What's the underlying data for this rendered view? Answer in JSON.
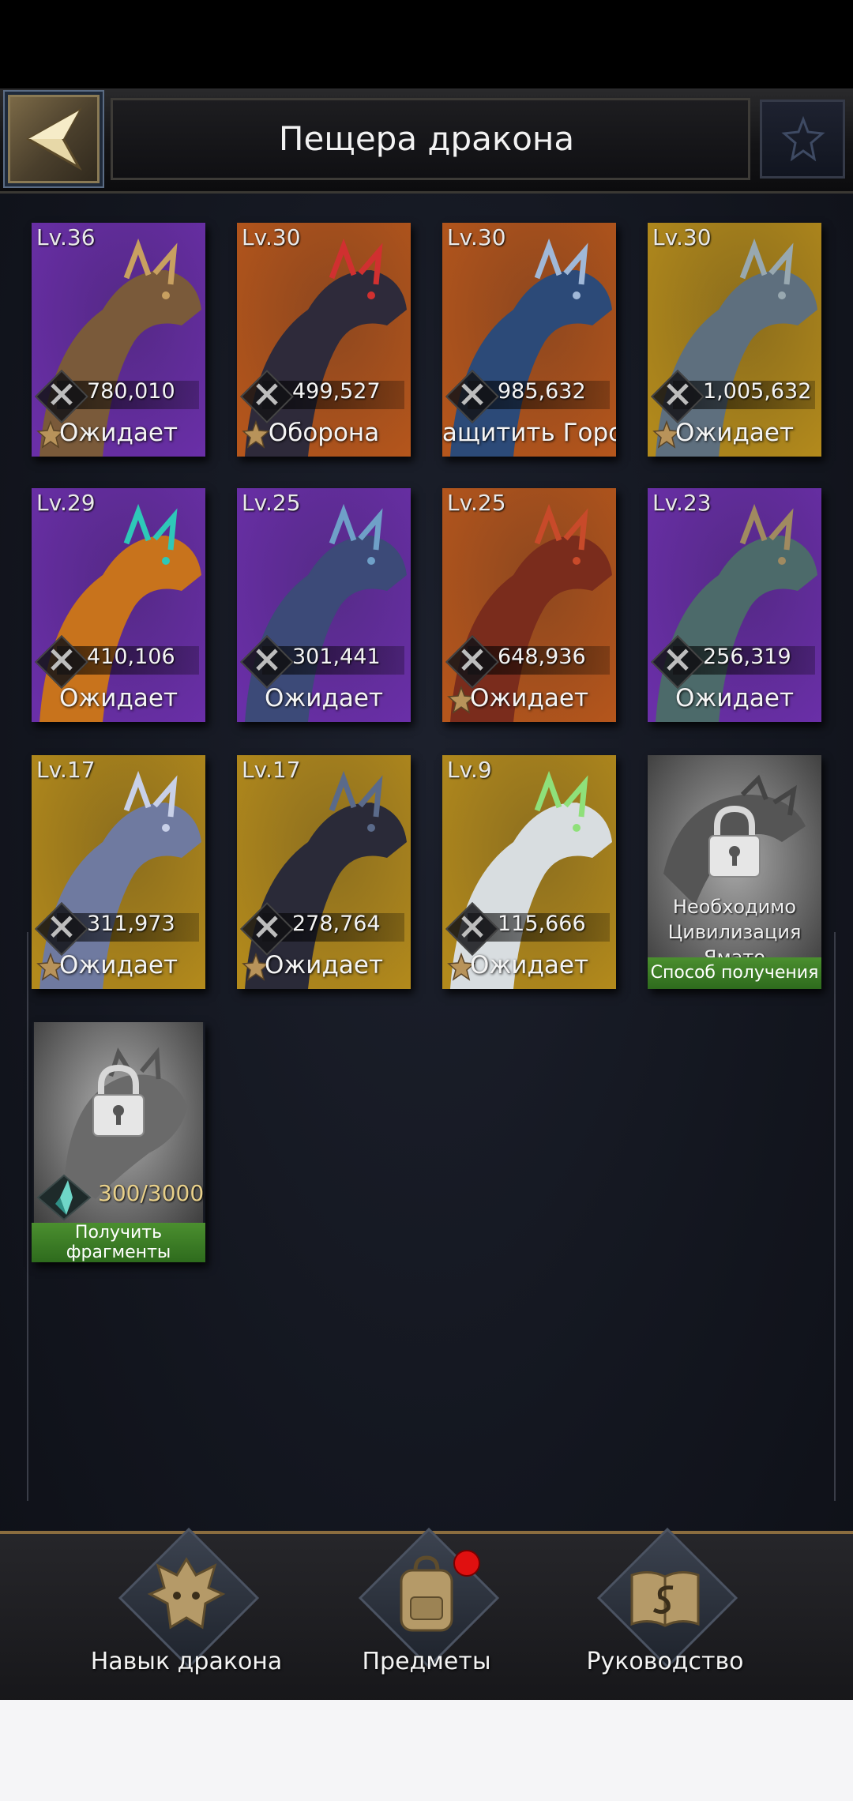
{
  "header": {
    "title": "Пещера дракона"
  },
  "dragons": [
    {
      "level": "Lv.36",
      "power": "780,010",
      "status": "Ожидает",
      "star": true,
      "bg": "#6a2fa8"
    },
    {
      "level": "Lv.30",
      "power": "499,527",
      "status": "Оборона",
      "star": true,
      "bg": "#b5561c"
    },
    {
      "level": "Lv.30",
      "power": "985,632",
      "status": "Защитить Город",
      "star": false,
      "bg": "#b5561c"
    },
    {
      "level": "Lv.30",
      "power": "1,005,632",
      "status": "Ожидает",
      "star": true,
      "bg": "#b38a1c"
    },
    {
      "level": "Lv.29",
      "power": "410,106",
      "status": "Ожидает",
      "star": false,
      "bg": "#6a2fa8"
    },
    {
      "level": "Lv.25",
      "power": "301,441",
      "status": "Ожидает",
      "star": false,
      "bg": "#6a2fa8"
    },
    {
      "level": "Lv.25",
      "power": "648,936",
      "status": "Ожидает",
      "star": true,
      "bg": "#b5561c"
    },
    {
      "level": "Lv.23",
      "power": "256,319",
      "status": "Ожидает",
      "star": false,
      "bg": "#6a2fa8"
    },
    {
      "level": "Lv.17",
      "power": "311,973",
      "status": "Ожидает",
      "star": true,
      "bg": "#b38a1c"
    },
    {
      "level": "Lv.17",
      "power": "278,764",
      "status": "Ожидает",
      "star": true,
      "bg": "#b38a1c"
    },
    {
      "level": "Lv.9",
      "power": "115,666",
      "status": "Ожидает",
      "star": true,
      "bg": "#b38a1c"
    }
  ],
  "locked_dragon": {
    "requirement_line1": "Необходимо",
    "requirement_line2": "Цивилизация",
    "requirement_line3": "Ямато",
    "button": "Способ получения"
  },
  "fragment_dragon": {
    "count": "300/3000",
    "button_line1": "Получить",
    "button_line2": "фрагменты"
  },
  "bottom_nav": {
    "skill": "Навык дракона",
    "items": "Предметы",
    "guide": "Руководство"
  },
  "colors": {
    "purple_card": "#6a2fa8",
    "orange_card": "#b5561c",
    "gold_card": "#b38a1c",
    "green_button": "#3c7d26",
    "notification": "#e01010"
  }
}
